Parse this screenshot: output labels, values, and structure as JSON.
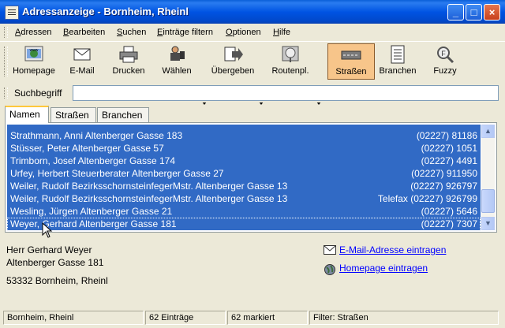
{
  "window": {
    "title": "Adressanzeige - Bornheim, Rheinl",
    "buttons": {
      "minimize": "_",
      "maximize": "□",
      "close": "×"
    }
  },
  "menu": [
    {
      "label": "Adressen",
      "accel": "A"
    },
    {
      "label": "Bearbeiten",
      "accel": "B"
    },
    {
      "label": "Suchen",
      "accel": "S"
    },
    {
      "label": "Einträge filtern",
      "accel": "E"
    },
    {
      "label": "Optionen",
      "accel": "O"
    },
    {
      "label": "Hilfe",
      "accel": "H"
    }
  ],
  "toolbar": [
    {
      "label": "Homepage",
      "icon": "homepage-icon"
    },
    {
      "label": "E-Mail",
      "icon": "email-icon"
    },
    {
      "label": "Drucken",
      "icon": "printer-icon"
    },
    {
      "label": "Wählen",
      "icon": "dial-icon"
    },
    {
      "label": "Übergeben",
      "icon": "export-icon"
    },
    {
      "label": "Routenpl.",
      "icon": "route-icon"
    },
    {
      "label": "Straßen",
      "icon": "streets-icon",
      "active": true
    },
    {
      "label": "Branchen",
      "icon": "branches-icon"
    },
    {
      "label": "Fuzzy",
      "icon": "fuzzy-icon"
    }
  ],
  "search": {
    "label": "Suchbegriff",
    "value": ""
  },
  "tabs": [
    {
      "label": "Namen",
      "active": true
    },
    {
      "label": "Straßen",
      "active": false
    },
    {
      "label": "Branchen",
      "active": false
    }
  ],
  "list": [
    {
      "name": "Strathmann, Anni Altenberger Gasse 183",
      "phone": "(02227) 81186"
    },
    {
      "name": "Stüsser, Peter Altenberger Gasse 57",
      "phone": "(02227) 1051"
    },
    {
      "name": "Trimborn, Josef Altenberger Gasse 174",
      "phone": "(02227) 4491"
    },
    {
      "name": "Urfey, Herbert Steuerberater Altenberger Gasse 27",
      "phone": "(02227) 911950"
    },
    {
      "name": "Weiler, Rudolf BezirksschornsteinfegerMstr. Altenberger Gasse 13",
      "phone": "(02227) 926797"
    },
    {
      "name": "Weiler, Rudolf BezirksschornsteinfegerMstr. Altenberger Gasse 13",
      "phone": "Telefax (02227) 926799"
    },
    {
      "name": "Wesling, Jürgen Altenberger Gasse 21",
      "phone": "(02227) 5646"
    },
    {
      "name": "Weyer, Gerhard Altenberger Gasse 181",
      "phone": "(02227) 7307",
      "focused": true
    }
  ],
  "detail": {
    "line1": "Herr Gerhard Weyer",
    "line2": "Altenberger Gasse 181",
    "line3": "53332 Bornheim, Rheinl",
    "email_link": "E-Mail-Adresse eintragen",
    "homepage_link": "Homepage eintragen"
  },
  "status": {
    "place": "Bornheim, Rheinl",
    "entries": "62 Einträge",
    "marked": "62 markiert",
    "filter": "Filter: Straßen"
  },
  "colors": {
    "titlebar": "#0054e3",
    "selection": "#316ac5",
    "link": "#0000ff",
    "active_button": "#f7c58a"
  }
}
